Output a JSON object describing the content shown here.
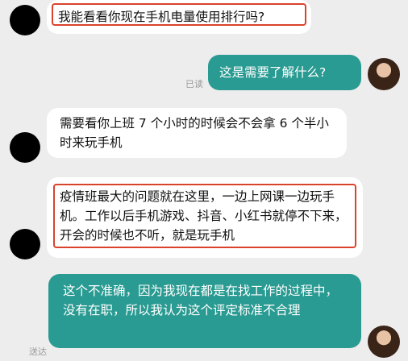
{
  "messages": [
    {
      "side": "left",
      "text": "我能看看你现在手机电量使用排行吗?"
    },
    {
      "side": "right",
      "text": "这是需要了解什么?",
      "status": "已读"
    },
    {
      "side": "left",
      "text": "需要看你上班 7 个小时的时候会不会拿 6 个半小时来玩手机"
    },
    {
      "side": "left",
      "text": "疫情班最大的问题就在这里，一边上网课一边玩手机。工作以后手机游戏、抖音、小红书就停不下来，开会的时候也不听，就是玩手机"
    },
    {
      "side": "right",
      "text": "这个不准确，因为我现在都是在找工作的过程中，没有在职，所以我认为这个评定标准不合理",
      "status": "送达"
    }
  ],
  "colors": {
    "background": "#ededed",
    "outgoing_bubble": "#2a9b92",
    "incoming_bubble": "#ffffff",
    "highlight_outline": "#d9432b"
  }
}
